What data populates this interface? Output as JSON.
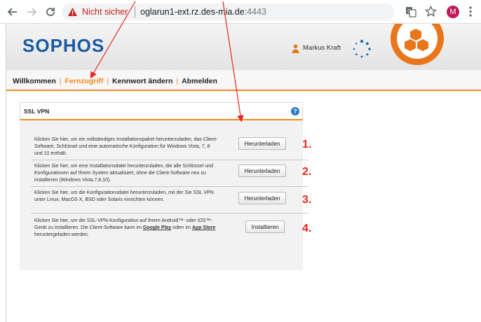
{
  "browser": {
    "insecure_label": "Nicht sicher",
    "url_host": "oglarun1-ext.rz.des-mia.de",
    "url_port": ":4443",
    "profile_initial": "M"
  },
  "header": {
    "logo_text": "SOPHOS",
    "user_name": "Markus Kraft"
  },
  "nav": {
    "items": [
      {
        "label": "Willkommen",
        "active": false
      },
      {
        "label": "Fernzugriff",
        "active": true
      },
      {
        "label": "Kennwort ändern",
        "active": false
      },
      {
        "label": "Abmelden",
        "active": false
      }
    ],
    "separator": "|"
  },
  "panel": {
    "title": "SSL VPN",
    "help_label": "?",
    "rows": [
      {
        "text": "Klicken Sie hier, um ein vollständiges Installationspaket herunterzuladen, das Client-Software, Schlüssel und eine automatische Konfiguration für Windows Vista, 7, 8 und 10 enthält.",
        "button": "Herunterladen",
        "step": "1."
      },
      {
        "text": "Klicken Sie hier, um eine Installationsdatei herunterzuladen, die alle Schlüssel und Konfigurationen auf Ihrem System aktualisiert, ohne die Client-Software neu zu installieren (Windows Vista,7,8,10).",
        "button": "Herunterladen",
        "step": "2."
      },
      {
        "text": "Klicken Sie hier, um die Konfigurationsdatei herunterzuladen, mit der Sie SSL VPN unter Linux, MacOS X, BSD oder Solaris einrichten können.",
        "button": "Herunterladen",
        "step": "3."
      },
      {
        "text_before": "Klicken Sie hier, um die SSL-VPN-Konfiguration auf Ihrem Android™- oder iOS™-Gerät zu installieren. Die Client-Software kann im ",
        "store_1": "Google Play",
        "text_mid": " oderr im ",
        "store_2": "App Store",
        "text_after": " heruntergeladen werden.",
        "button": "Installieren",
        "step": "4."
      }
    ]
  },
  "colors": {
    "accent_orange": "#f08a24",
    "sophos_blue": "#1b5aa3",
    "annotation_red": "#e8261c"
  }
}
